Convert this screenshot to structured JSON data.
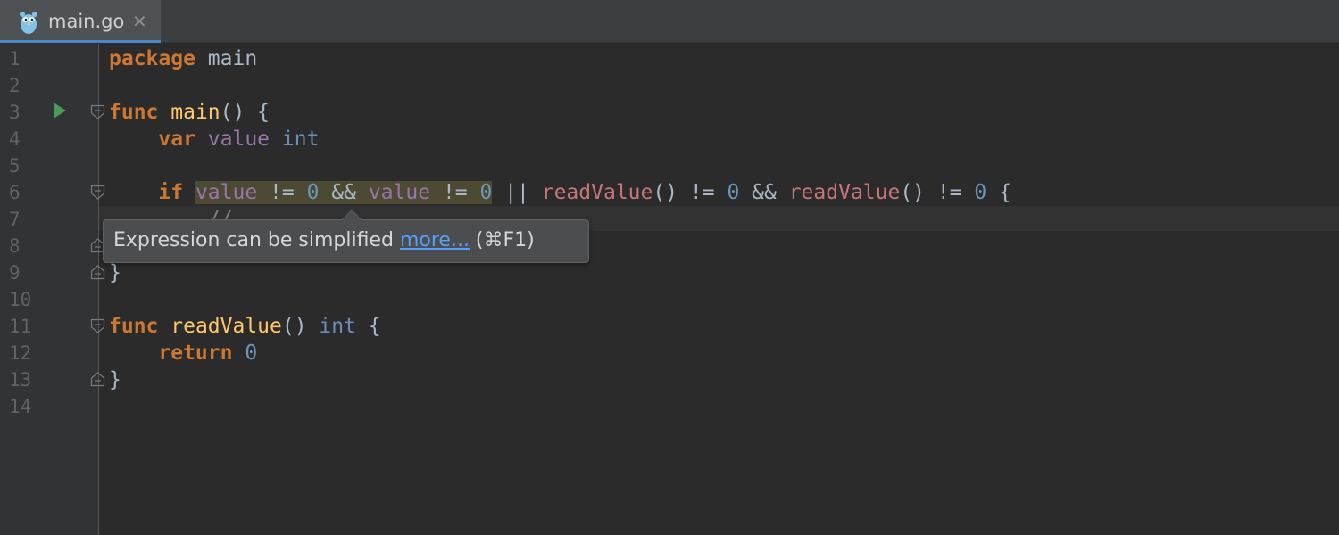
{
  "tab": {
    "filename": "main.go",
    "close_glyph": "✕",
    "icon": "gopher-icon"
  },
  "gutter": {
    "line_numbers": [
      "1",
      "2",
      "3",
      "4",
      "5",
      "6",
      "7",
      "8",
      "9",
      "10",
      "11",
      "12",
      "13",
      "14"
    ]
  },
  "code": {
    "line1": {
      "kw": "package",
      "rest": " main"
    },
    "line3": {
      "kw": "func",
      "name": "main",
      "rest": "() {"
    },
    "line4": {
      "indent": "    ",
      "kw": "var",
      "var": "value",
      "type": "int"
    },
    "line6": {
      "indent": "    ",
      "kw": "if",
      "v1": "value",
      "op1": " != ",
      "n1": "0",
      "and1": " && ",
      "v2": "value",
      "op2": " != ",
      "n2": "0",
      "or": " || ",
      "c1": "readValue",
      "p1": "()",
      "op3": " != ",
      "n3": "0",
      "and2": " && ",
      "c2": "readValue",
      "p2": "()",
      "op4": " != ",
      "n4": "0",
      "brace": " {"
    },
    "line7": {
      "indent": "        ",
      "cmt": "//"
    },
    "line9": {
      "brace": "}"
    },
    "line11": {
      "kw": "func",
      "name": "readValue",
      "rest": "() ",
      "type": "int",
      "brace": " {"
    },
    "line12": {
      "indent": "    ",
      "kw": "return",
      "num": "0"
    },
    "line13": {
      "brace": "}"
    }
  },
  "tooltip": {
    "message": "Expression can be simplified ",
    "link": "more...",
    "shortcut": " (⌘F1)"
  },
  "colors": {
    "background": "#2b2b2b",
    "keyword": "#cc7832",
    "function": "#ffc66d",
    "variable": "#9876aa",
    "number": "#6897bb",
    "call": "#c77575",
    "tab_accent": "#4a88c7"
  }
}
